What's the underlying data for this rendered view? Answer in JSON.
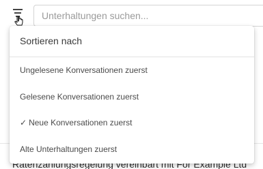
{
  "search": {
    "placeholder": "Unterhaltungen suchen..."
  },
  "sort_menu": {
    "header": "Sortieren nach",
    "options": [
      {
        "label": "Ungelesene Konversationen zuerst",
        "selected": false
      },
      {
        "label": "Gelesene Konversationen zuerst",
        "selected": false
      },
      {
        "label": "Neue Konversationen zuerst",
        "selected": true
      },
      {
        "label": "Alte Unterhaltungen zuerst",
        "selected": false
      }
    ],
    "check_glyph": "✓"
  },
  "conversation_list": {
    "preview_text": "Ratenzahlungsregelung vereinbart mit For Example Ltd"
  },
  "icons": {
    "filter_button": "sort-filter-icon",
    "cursor": "hand-pointer-icon"
  },
  "colors": {
    "text_primary": "#3a3a3a",
    "placeholder": "#9a9a9a",
    "border": "#d3d3d3"
  }
}
